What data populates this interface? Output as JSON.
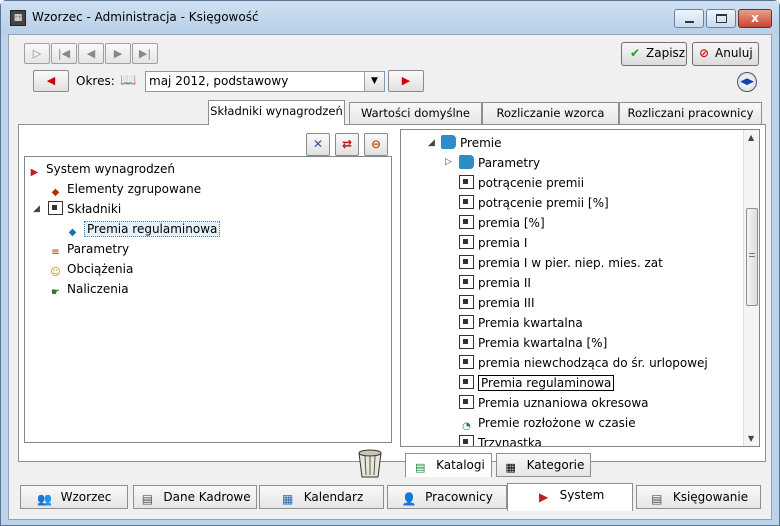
{
  "window": {
    "title": "Wzorzec - Administracja - Księgowość",
    "close_label": "x"
  },
  "toolbar": {
    "save_label": "Zapisz",
    "cancel_label": "Anuluj"
  },
  "period": {
    "label": "Okres:",
    "value": "maj 2012, podstawowy"
  },
  "tabs": [
    "Składniki wynagrodzeń",
    "Wartości domyślne",
    "Rozliczanie wzorca",
    "Rozliczani pracownicy"
  ],
  "left_tree": [
    {
      "label": "System wynagrodzeń"
    },
    {
      "label": "Elementy zgrupowane"
    },
    {
      "label": "Składniki"
    },
    {
      "label": "Premia regulaminowa"
    },
    {
      "label": "Parametry"
    },
    {
      "label": "Obciążenia"
    },
    {
      "label": "Naliczenia"
    }
  ],
  "right_tree": [
    {
      "label": "Premie"
    },
    {
      "label": "Parametry"
    },
    {
      "label": "potrącenie premii"
    },
    {
      "label": "potrącenie premii [%]"
    },
    {
      "label": "premia [%]"
    },
    {
      "label": "premia I"
    },
    {
      "label": "premia I w pier. niep. mies. zat"
    },
    {
      "label": "premia II"
    },
    {
      "label": "premia III"
    },
    {
      "label": "Premia kwartalna"
    },
    {
      "label": "Premia kwartalna [%]"
    },
    {
      "label": "premia niewchodząca do śr. urlopowej"
    },
    {
      "label": "Premia regulaminowa"
    },
    {
      "label": "Premia uznaniowa okresowa"
    },
    {
      "label": "Premie rozłożone w czasie"
    },
    {
      "label": "Trzynastka"
    }
  ],
  "right_tabs": [
    "Katalogi",
    "Kategorie"
  ],
  "bottom_tabs": [
    "Wzorzec",
    "Dane Kadrowe",
    "Kalendarz",
    "Pracownicy",
    "System",
    "Księgowanie"
  ]
}
